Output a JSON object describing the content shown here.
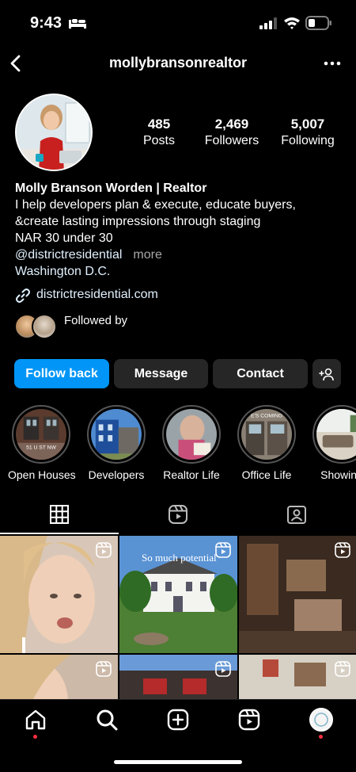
{
  "status_bar": {
    "time": "9:43"
  },
  "header": {
    "username": "mollybransonrealtor"
  },
  "stats": [
    {
      "value": "485",
      "label": "Posts"
    },
    {
      "value": "2,469",
      "label": "Followers"
    },
    {
      "value": "5,007",
      "label": "Following"
    }
  ],
  "bio": {
    "name": "Molly Branson Worden | Realtor",
    "line1": "I help developers plan & execute, educate buyers,",
    "line2": "&create lasting impressions through staging",
    "line3": "NAR 30 under 30",
    "mention": "@districtresidential",
    "more": "more",
    "location": "Washington D.C.",
    "website": "districtresidential.com"
  },
  "followed_by": {
    "label": "Followed by"
  },
  "actions": {
    "follow_back": "Follow back",
    "message": "Message",
    "contact": "Contact"
  },
  "highlights": [
    {
      "label": "Open Houses",
      "overlay": "51 U ST NW"
    },
    {
      "label": "Developers",
      "overlay": ""
    },
    {
      "label": "Realtor Life",
      "overlay": ""
    },
    {
      "label": "Office Life",
      "overlay": "E'S COMING"
    },
    {
      "label": "Showing",
      "overlay": ""
    }
  ],
  "tabs": [
    "grid-icon",
    "reels-icon",
    "tagged-icon"
  ],
  "grid": {
    "items": [
      {
        "caption": ""
      },
      {
        "caption": "So much potential"
      },
      {
        "caption": ""
      },
      {
        "caption": ""
      },
      {
        "caption": ""
      },
      {
        "caption": ""
      }
    ]
  },
  "colors": {
    "background": "#000000",
    "primary_button": "#0095f6",
    "secondary_button": "#262626",
    "link": "#e0f1ff",
    "muted": "#a8a8a8",
    "notification_dot": "#ff3040"
  }
}
